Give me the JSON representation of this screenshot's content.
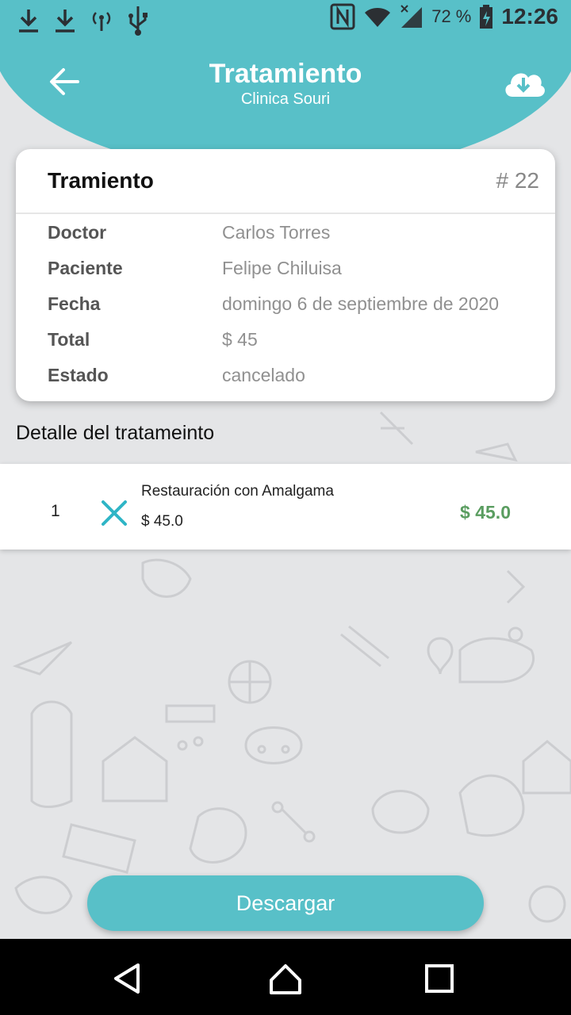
{
  "status_bar": {
    "left_icons": [
      "download-icon",
      "download-icon",
      "signal-icon",
      "usb-icon"
    ],
    "right_icons": [
      "nfc-icon",
      "wifi-icon",
      "cell-signal-icon",
      "battery-charging-icon"
    ],
    "battery": "72 %",
    "time": "12:26"
  },
  "header": {
    "title": "Tratamiento",
    "subtitle": "Clinica Souri",
    "back_icon": "arrow-left-icon",
    "download_icon": "cloud-download-icon",
    "color": "#58c0c8"
  },
  "card": {
    "title": "Tramiento",
    "number": "# 22",
    "rows": [
      {
        "label": "Doctor",
        "value": "Carlos Torres"
      },
      {
        "label": "Paciente",
        "value": "Felipe Chiluisa"
      },
      {
        "label": "Fecha",
        "value": "domingo 6 de septiembre de 2020"
      },
      {
        "label": "Total",
        "value": "$ 45"
      },
      {
        "label": "Estado",
        "value": "cancelado"
      }
    ]
  },
  "section_title": "Detalle del tratameinto",
  "items": [
    {
      "quantity": "1",
      "name": "Restauración con Amalgama",
      "price": "$ 45.0",
      "total": "$ 45.0",
      "remove_icon": "close-icon"
    }
  ],
  "actions": {
    "download_label": "Descargar"
  },
  "nav": {
    "icons": [
      "back-triangle-icon",
      "home-icon",
      "recents-icon"
    ]
  },
  "colors": {
    "accent": "#58c0c8",
    "total_green": "#5a9d60",
    "background": "#e4e5e7"
  }
}
